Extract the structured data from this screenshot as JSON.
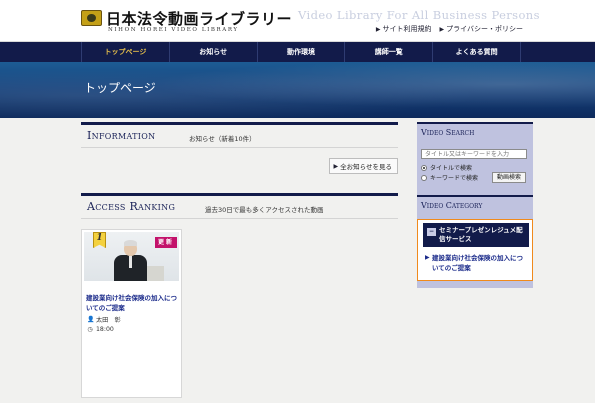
{
  "header": {
    "site_title": "日本法令動画ライブラリー",
    "site_subtitle": "NIHON HOREI VIDEO LIBRARY",
    "tagline": "Video Library For All Business Persons",
    "links": [
      {
        "label": "サイト利用規約",
        "icon": "arrow-right-icon"
      },
      {
        "label": "プライバシー・ポリシー",
        "icon": "arrow-right-icon"
      }
    ]
  },
  "nav": {
    "items": [
      {
        "label": "トップページ",
        "active": true
      },
      {
        "label": "お知らせ",
        "active": false
      },
      {
        "label": "動作環境",
        "active": false
      },
      {
        "label": "講師一覧",
        "active": false
      },
      {
        "label": "よくある質問",
        "active": false
      }
    ]
  },
  "hero": {
    "title": "トップページ"
  },
  "information": {
    "title": "Information",
    "note": "お知らせ（新着10件）",
    "all_news_label": "全お知らせを見る"
  },
  "ranking": {
    "title": "Access Ranking",
    "note": "過去30日で最も多くアクセスされた動画",
    "items": [
      {
        "rank": "1",
        "badge": "更新",
        "title": "建設業向け社会保険の加入についてのご提案",
        "speaker": "太田　彰",
        "duration": "18:00"
      }
    ]
  },
  "sidebar": {
    "search": {
      "title": "Video Search",
      "placeholder": "タイトル又はキーワードを入力",
      "options": [
        {
          "label": "タイトルで検索",
          "checked": true
        },
        {
          "label": "キーワードで検索",
          "checked": false
        }
      ],
      "button_label": "動画検索"
    },
    "category": {
      "title": "Video Category",
      "main_toggle": "−",
      "main_label": "セミナープレゼンレジュメ配信サービス",
      "sub_label": "建設業向け社会保険の加入についてのご提案"
    }
  },
  "colors": {
    "navy": "#121b4a",
    "accent_gold": "#e8c04a",
    "new_badge": "#c3126b",
    "sidebar_bg": "#bfc2df",
    "highlight_border": "#f08a1c"
  }
}
